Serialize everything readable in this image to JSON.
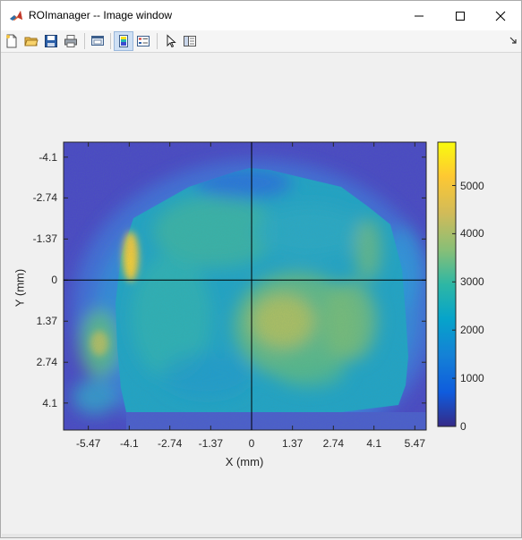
{
  "window": {
    "title": "ROImanager -- Image window",
    "controls": {
      "minimize": "minimize-icon",
      "maximize": "maximize-icon",
      "close": "close-icon"
    }
  },
  "toolbar": {
    "buttons": [
      {
        "name": "new-figure",
        "icon": "new-file-icon"
      },
      {
        "name": "open-file",
        "icon": "folder-open-icon"
      },
      {
        "name": "save",
        "icon": "floppy-disk-icon"
      },
      {
        "name": "print",
        "icon": "printer-icon"
      },
      {
        "name": "link-plot",
        "icon": "link-plot-icon"
      },
      {
        "name": "colorbar-toggle",
        "icon": "colorbar-icon",
        "active": true
      },
      {
        "name": "legend-toggle",
        "icon": "legend-icon"
      },
      {
        "name": "edit-plot",
        "icon": "pointer-arrow-icon"
      },
      {
        "name": "plot-tools",
        "icon": "property-panel-icon"
      }
    ],
    "dock_icon": "dock-arrow-icon"
  },
  "chart_data": {
    "type": "heatmap",
    "title": "",
    "xlabel": "X (mm)",
    "ylabel": "Y (mm)",
    "xticks": [
      -5.47,
      -4.1,
      -2.74,
      -1.37,
      0,
      1.37,
      2.74,
      4.1,
      5.47
    ],
    "xtick_labels": [
      "-5.47",
      "-4.1",
      "-2.74",
      "-1.37",
      "0",
      "1.37",
      "2.74",
      "4.1",
      "5.47"
    ],
    "yticks": [
      -4.1,
      -2.74,
      -1.37,
      0,
      1.37,
      2.74,
      4.1
    ],
    "ytick_labels": [
      "-4.1",
      "-2.74",
      "-1.37",
      "0",
      "1.37",
      "2.74",
      "4.1"
    ],
    "xlim": [
      -6.3,
      5.85
    ],
    "ylim": [
      -4.6,
      5.0
    ],
    "y_axis_reversed": true,
    "crosshair": {
      "x": 0,
      "y": 0
    },
    "colormap": "parula",
    "colorbar": {
      "clim": [
        0,
        5900
      ],
      "ticks": [
        0,
        1000,
        2000,
        3000,
        4000,
        5000
      ],
      "tick_labels": [
        "0",
        "1000",
        "2000",
        "3000",
        "4000",
        "5000"
      ]
    },
    "description_values": {
      "background_level": 800,
      "sample_body_level": 2600,
      "hotspot_left_level": 5200,
      "right_region_level": 3800
    }
  },
  "colors": {
    "titlebar_bg": "#ffffff",
    "window_bg": "#f0f0f0",
    "axes_frame": "#262626",
    "crosshair": "#000000"
  }
}
